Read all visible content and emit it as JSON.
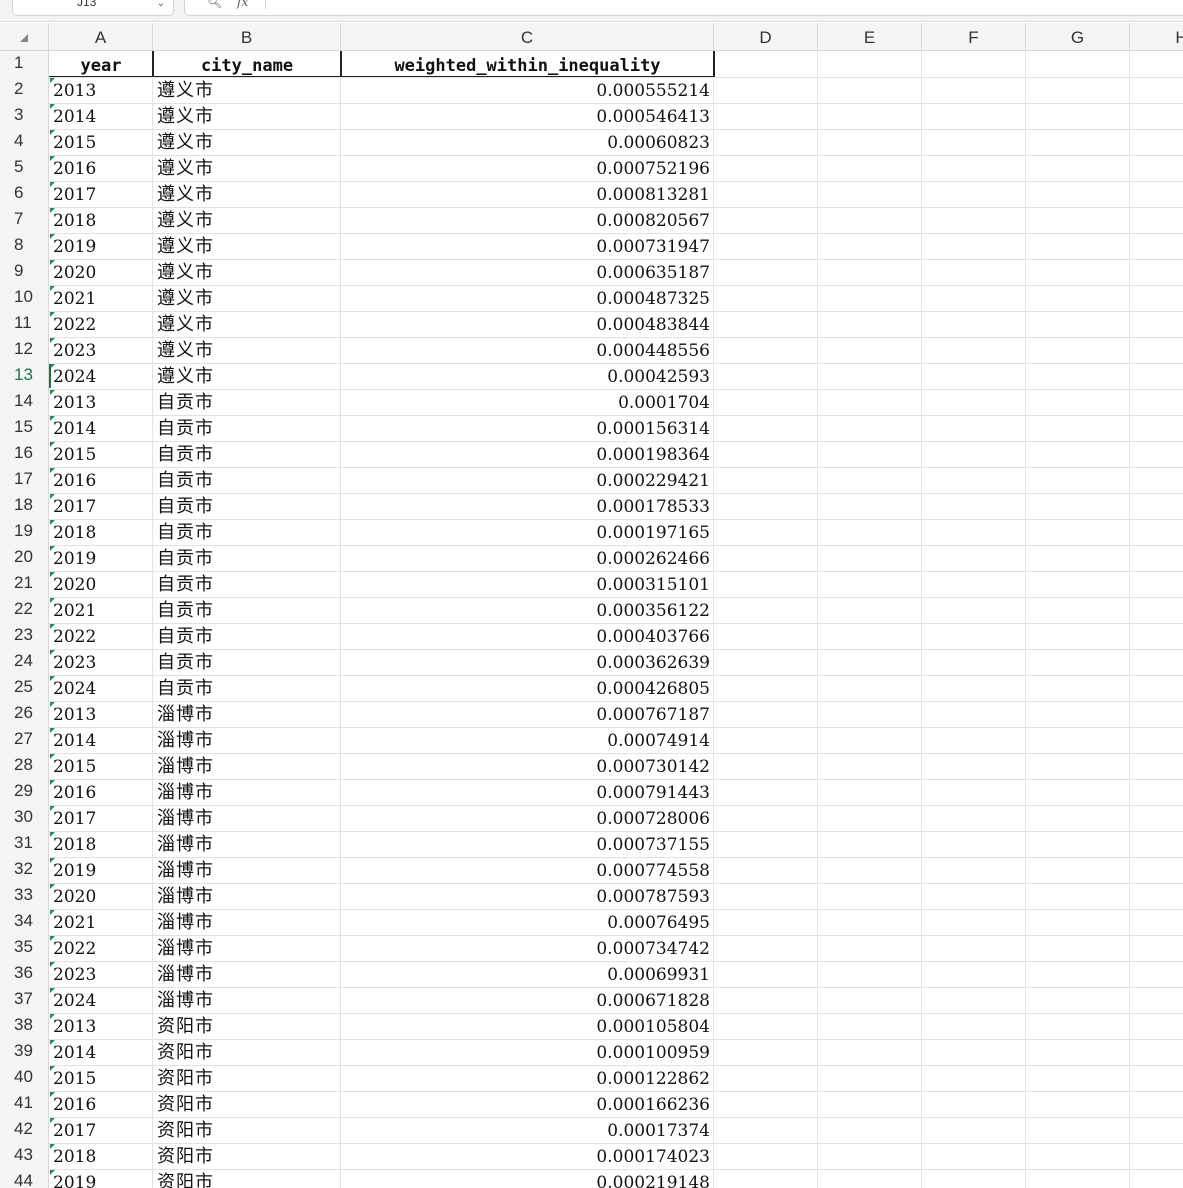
{
  "formula_bar": {
    "cell_ref": "J13",
    "fx_label": "fx",
    "zoom_icon": "zoom-icon",
    "formula": ""
  },
  "columns": [
    "A",
    "B",
    "C",
    "D",
    "E",
    "F",
    "G",
    "H"
  ],
  "active_row": 13,
  "header_row": {
    "year": "year",
    "city": "city_name",
    "value": "weighted_within_inequality"
  },
  "rows": [
    {
      "year": "2013",
      "city": "遵义市",
      "value": "0.000555214"
    },
    {
      "year": "2014",
      "city": "遵义市",
      "value": "0.000546413"
    },
    {
      "year": "2015",
      "city": "遵义市",
      "value": "0.00060823"
    },
    {
      "year": "2016",
      "city": "遵义市",
      "value": "0.000752196"
    },
    {
      "year": "2017",
      "city": "遵义市",
      "value": "0.000813281"
    },
    {
      "year": "2018",
      "city": "遵义市",
      "value": "0.000820567"
    },
    {
      "year": "2019",
      "city": "遵义市",
      "value": "0.000731947"
    },
    {
      "year": "2020",
      "city": "遵义市",
      "value": "0.000635187"
    },
    {
      "year": "2021",
      "city": "遵义市",
      "value": "0.000487325"
    },
    {
      "year": "2022",
      "city": "遵义市",
      "value": "0.000483844"
    },
    {
      "year": "2023",
      "city": "遵义市",
      "value": "0.000448556"
    },
    {
      "year": "2024",
      "city": "遵义市",
      "value": "0.00042593"
    },
    {
      "year": "2013",
      "city": "自贡市",
      "value": "0.0001704"
    },
    {
      "year": "2014",
      "city": "自贡市",
      "value": "0.000156314"
    },
    {
      "year": "2015",
      "city": "自贡市",
      "value": "0.000198364"
    },
    {
      "year": "2016",
      "city": "自贡市",
      "value": "0.000229421"
    },
    {
      "year": "2017",
      "city": "自贡市",
      "value": "0.000178533"
    },
    {
      "year": "2018",
      "city": "自贡市",
      "value": "0.000197165"
    },
    {
      "year": "2019",
      "city": "自贡市",
      "value": "0.000262466"
    },
    {
      "year": "2020",
      "city": "自贡市",
      "value": "0.000315101"
    },
    {
      "year": "2021",
      "city": "自贡市",
      "value": "0.000356122"
    },
    {
      "year": "2022",
      "city": "自贡市",
      "value": "0.000403766"
    },
    {
      "year": "2023",
      "city": "自贡市",
      "value": "0.000362639"
    },
    {
      "year": "2024",
      "city": "自贡市",
      "value": "0.000426805"
    },
    {
      "year": "2013",
      "city": "淄博市",
      "value": "0.000767187"
    },
    {
      "year": "2014",
      "city": "淄博市",
      "value": "0.00074914"
    },
    {
      "year": "2015",
      "city": "淄博市",
      "value": "0.000730142"
    },
    {
      "year": "2016",
      "city": "淄博市",
      "value": "0.000791443"
    },
    {
      "year": "2017",
      "city": "淄博市",
      "value": "0.000728006"
    },
    {
      "year": "2018",
      "city": "淄博市",
      "value": "0.000737155"
    },
    {
      "year": "2019",
      "city": "淄博市",
      "value": "0.000774558"
    },
    {
      "year": "2020",
      "city": "淄博市",
      "value": "0.000787593"
    },
    {
      "year": "2021",
      "city": "淄博市",
      "value": "0.00076495"
    },
    {
      "year": "2022",
      "city": "淄博市",
      "value": "0.000734742"
    },
    {
      "year": "2023",
      "city": "淄博市",
      "value": "0.00069931"
    },
    {
      "year": "2024",
      "city": "淄博市",
      "value": "0.000671828"
    },
    {
      "year": "2013",
      "city": "资阳市",
      "value": "0.000105804"
    },
    {
      "year": "2014",
      "city": "资阳市",
      "value": "0.000100959"
    },
    {
      "year": "2015",
      "city": "资阳市",
      "value": "0.000122862"
    },
    {
      "year": "2016",
      "city": "资阳市",
      "value": "0.000166236"
    },
    {
      "year": "2017",
      "city": "资阳市",
      "value": "0.00017374"
    },
    {
      "year": "2018",
      "city": "资阳市",
      "value": "0.000174023"
    },
    {
      "year": "2019",
      "city": "资阳市",
      "value": "0.000219148"
    }
  ],
  "colors": {
    "accent": "#217346",
    "tick": "#1f8f4e",
    "gridline": "#e2e2e2",
    "header_bg": "#f5f5f5"
  }
}
